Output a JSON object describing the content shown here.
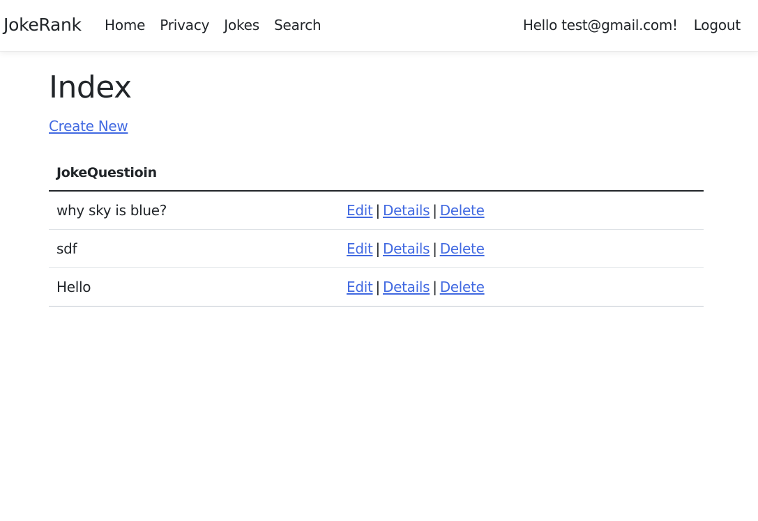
{
  "navbar": {
    "brand": "JokeRank",
    "links": [
      "Home",
      "Privacy",
      "Jokes",
      "Search"
    ],
    "greeting": "Hello test@gmail.com!",
    "logout": "Logout"
  },
  "page": {
    "title": "Index",
    "create_new": "Create New"
  },
  "table": {
    "header": "JokeQuestioin",
    "actions": {
      "edit": "Edit",
      "details": "Details",
      "delete": "Delete",
      "separator": "|"
    },
    "rows": [
      {
        "question": "why sky is blue?"
      },
      {
        "question": "sdf"
      },
      {
        "question": "Hello"
      }
    ]
  },
  "colors": {
    "link": "#4169e1",
    "text": "#212529",
    "row_border": "#dee2e6"
  }
}
